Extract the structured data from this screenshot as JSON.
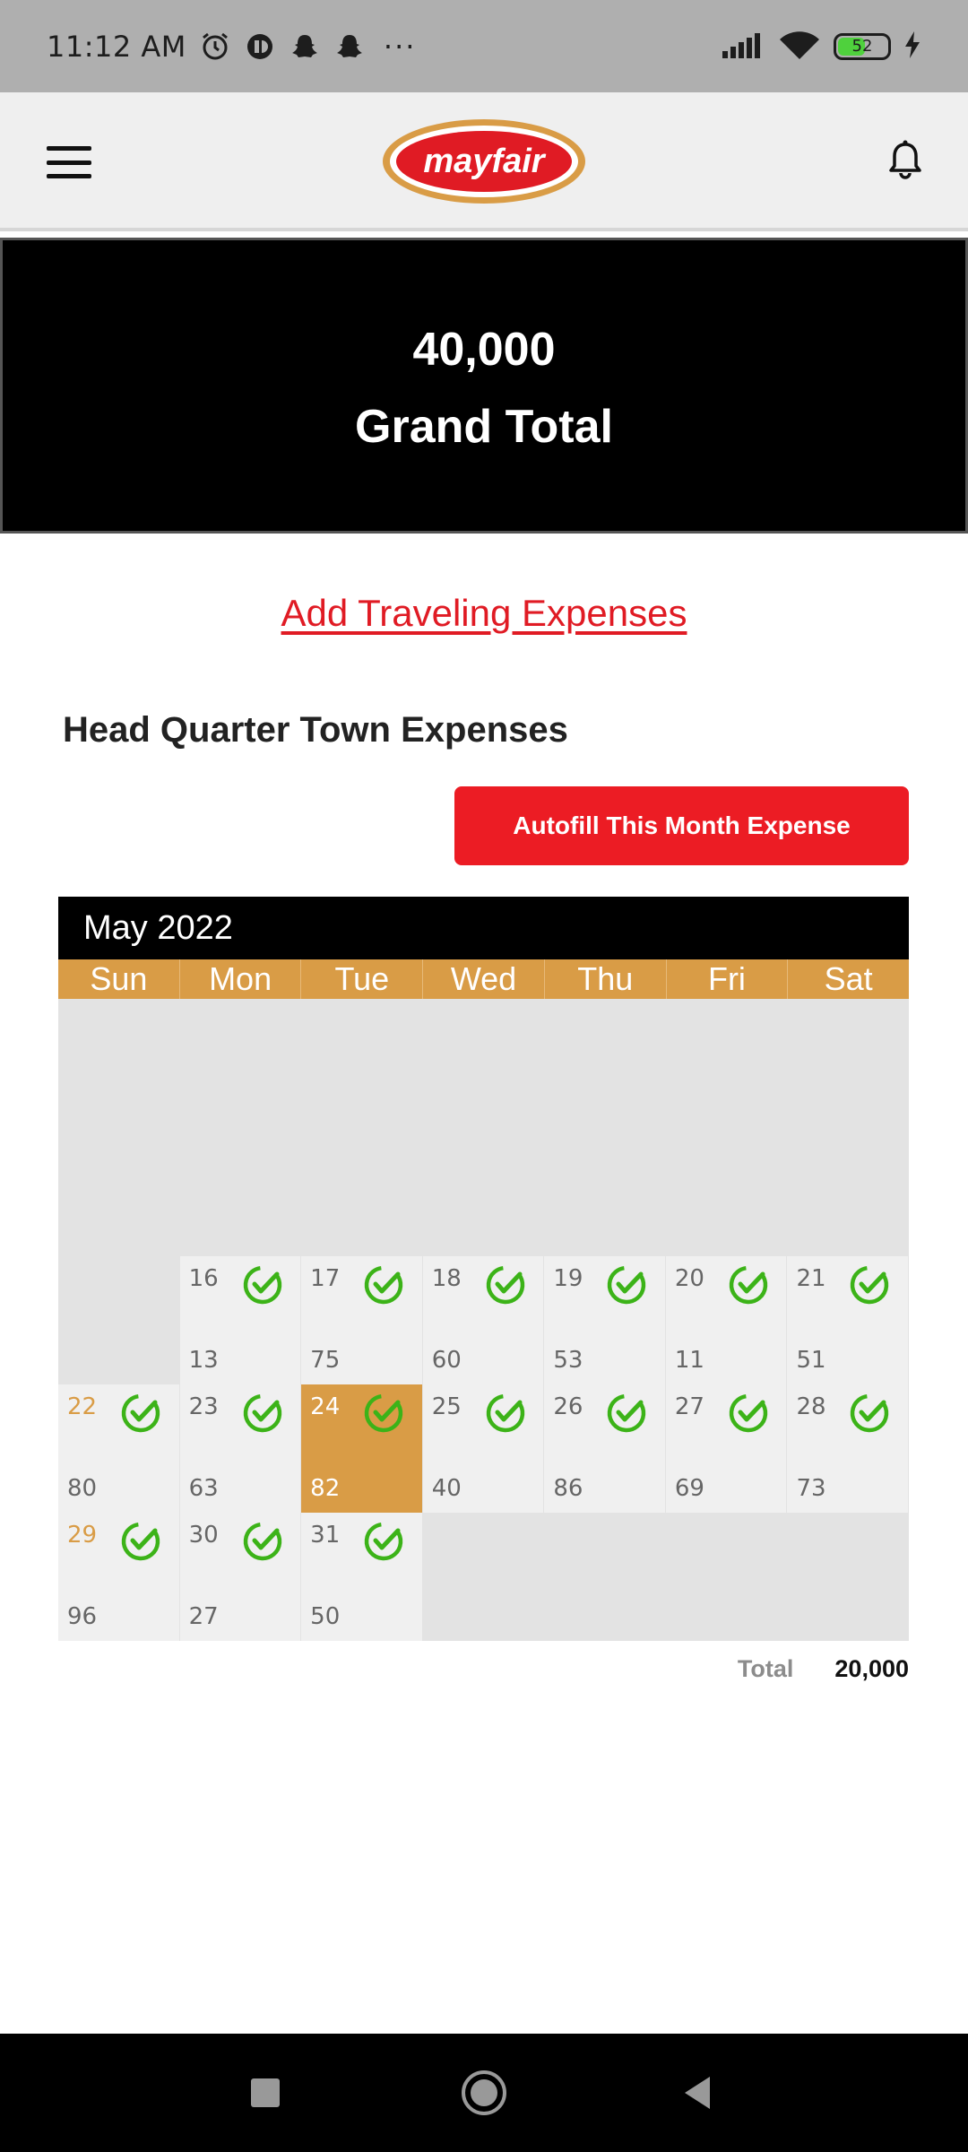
{
  "status_bar": {
    "time": "11:12 AM",
    "dots": "···",
    "battery_level": "52",
    "icons_left": [
      "alarm-icon",
      "app-icon",
      "snapchat-icon",
      "snapchat-icon"
    ],
    "icons_right": [
      "signal-icon",
      "wifi-icon",
      "battery-icon",
      "charging-icon"
    ]
  },
  "header": {
    "logo_text": "mayfair",
    "menu_icon": "menu-icon",
    "bell_icon": "bell-icon"
  },
  "grand_total": {
    "value": "40,000",
    "label": "Grand Total"
  },
  "add_traveling_link": "Add Traveling Expenses",
  "hq_section": {
    "title": "Head Quarter Town Expenses",
    "autofill_label": "Autofill This Month Expense"
  },
  "calendar": {
    "month_label": "May 2022",
    "weekdays": [
      "Sun",
      "Mon",
      "Tue",
      "Wed",
      "Thu",
      "Fri",
      "Sat"
    ],
    "rows": [
      [
        {
          "empty": true
        },
        {
          "day": "16",
          "amount": "13",
          "checked": true
        },
        {
          "day": "17",
          "amount": "75",
          "checked": true
        },
        {
          "day": "18",
          "amount": "60",
          "checked": true
        },
        {
          "day": "19",
          "amount": "53",
          "checked": true
        },
        {
          "day": "20",
          "amount": "11",
          "checked": true
        },
        {
          "day": "21",
          "amount": "51",
          "checked": true
        }
      ],
      [
        {
          "day": "22",
          "amount": "80",
          "checked": true,
          "sunday": true
        },
        {
          "day": "23",
          "amount": "63",
          "checked": true
        },
        {
          "day": "24",
          "amount": "82",
          "checked": true,
          "today": true
        },
        {
          "day": "25",
          "amount": "40",
          "checked": true
        },
        {
          "day": "26",
          "amount": "86",
          "checked": true
        },
        {
          "day": "27",
          "amount": "69",
          "checked": true
        },
        {
          "day": "28",
          "amount": "73",
          "checked": true
        }
      ],
      [
        {
          "day": "29",
          "amount": "96",
          "checked": true,
          "sunday": true
        },
        {
          "day": "30",
          "amount": "27",
          "checked": true
        },
        {
          "day": "31",
          "amount": "50",
          "checked": true
        },
        {
          "empty": true
        },
        {
          "empty": true
        },
        {
          "empty": true
        },
        {
          "empty": true
        }
      ]
    ],
    "total_label": "Total",
    "total_value": "20,000"
  },
  "colors": {
    "accent_red": "#ec1c24",
    "gold": "#d99c46",
    "check_green": "#3cb318"
  },
  "nav_bar": {
    "buttons": [
      "recents-square-icon",
      "home-circle-icon",
      "back-triangle-icon"
    ]
  }
}
